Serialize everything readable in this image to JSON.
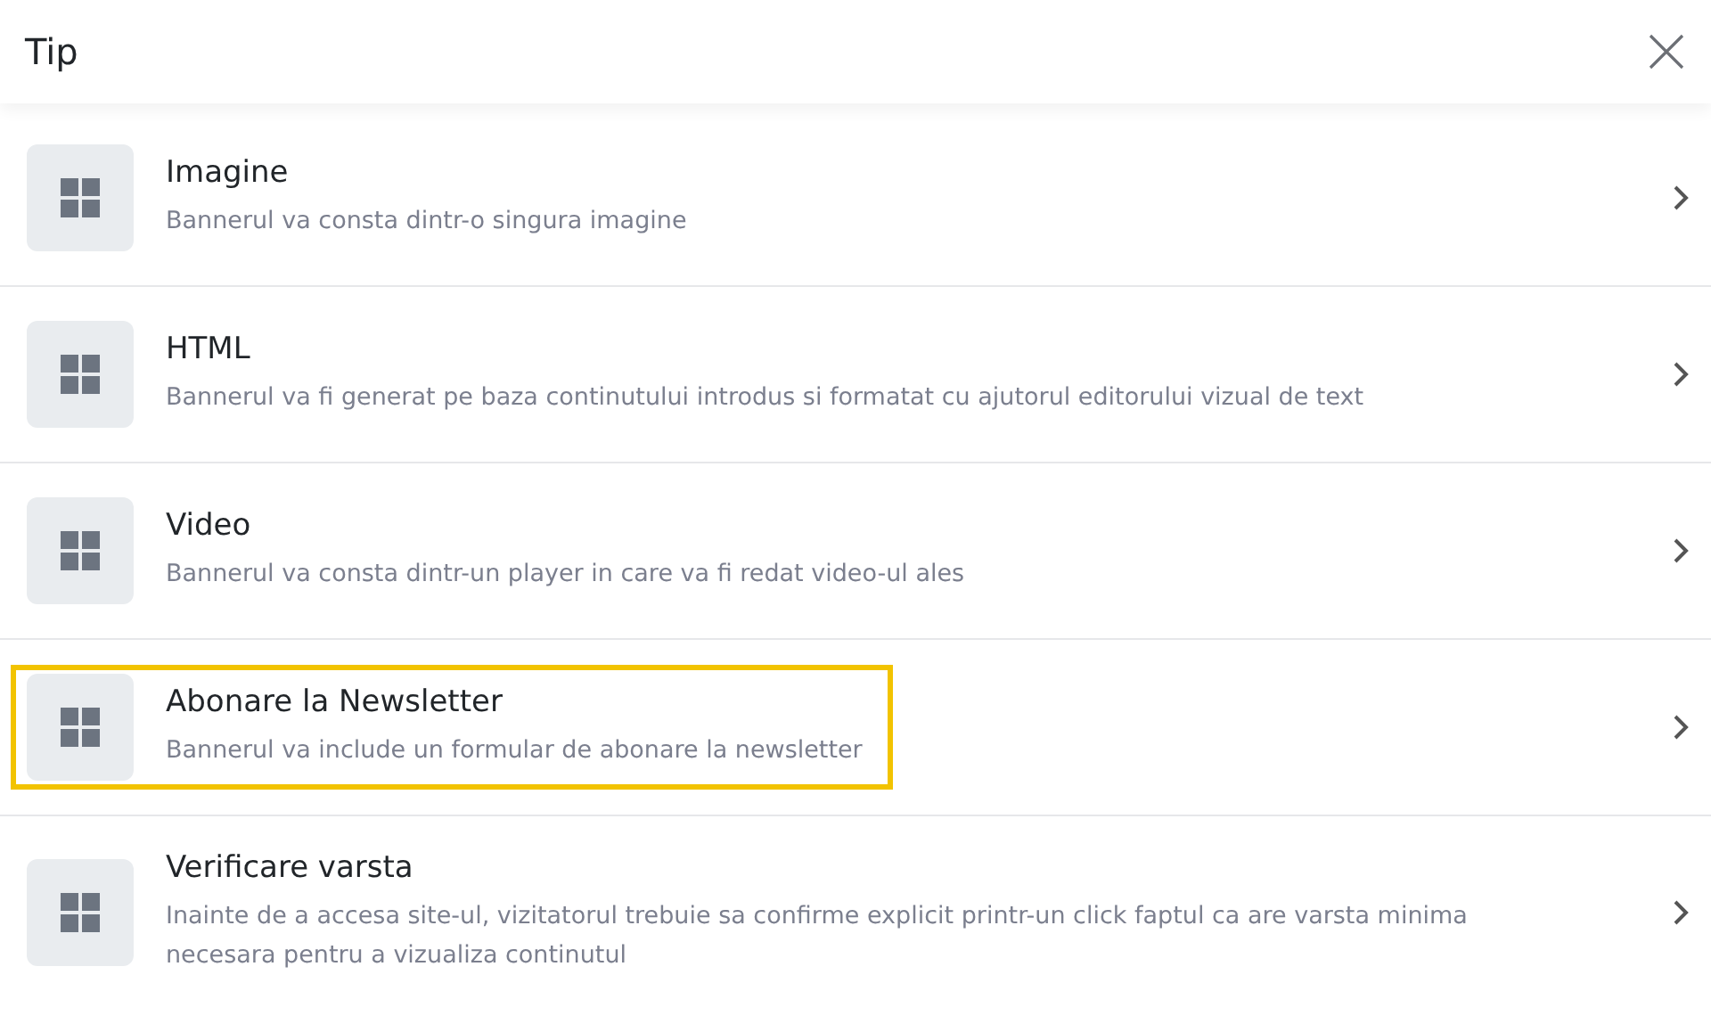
{
  "dialog": {
    "title": "Tip"
  },
  "options": [
    {
      "title": "Imagine",
      "description": "Bannerul va consta dintr-o singura imagine",
      "highlighted": false
    },
    {
      "title": "HTML",
      "description": "Bannerul va fi generat pe baza continutului introdus si formatat cu ajutorul editorului vizual de text",
      "highlighted": false
    },
    {
      "title": "Video",
      "description": "Bannerul va consta dintr-un player in care va fi redat video-ul ales",
      "highlighted": false
    },
    {
      "title": "Abonare la Newsletter",
      "description": "Bannerul va include un formular de abonare la newsletter",
      "highlighted": true
    },
    {
      "title": "Verificare varsta",
      "description": "Inainte de a accesa site-ul, vizitatorul trebuie sa confirme explicit printr-un click faptul ca are varsta minima necesara pentru a vizualiza continutul",
      "highlighted": false
    }
  ]
}
